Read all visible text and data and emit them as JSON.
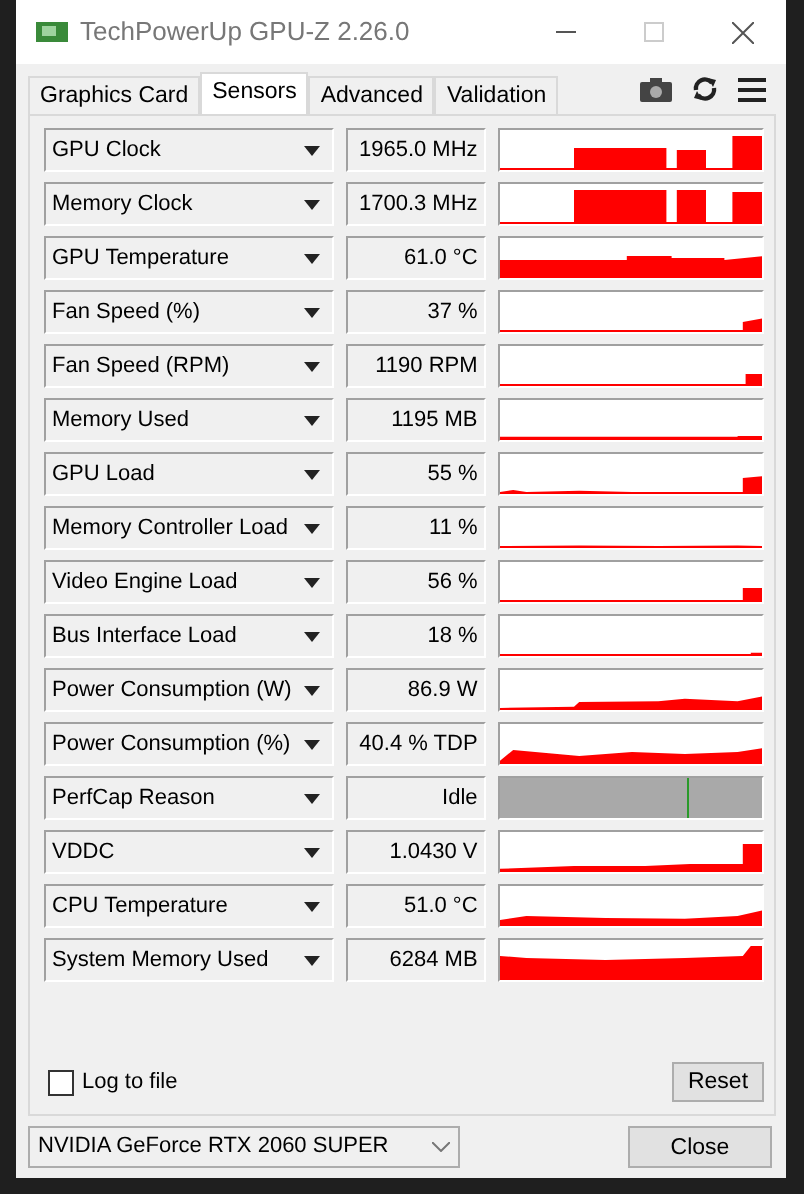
{
  "window": {
    "title": "TechPowerUp GPU-Z 2.26.0"
  },
  "tabs": [
    {
      "label": "Graphics Card",
      "selected": false
    },
    {
      "label": "Sensors",
      "selected": true
    },
    {
      "label": "Advanced",
      "selected": false
    },
    {
      "label": "Validation",
      "selected": false
    }
  ],
  "sensors": [
    {
      "name": "GPU Clock",
      "value": "1965.0 MHz",
      "kind": "graph"
    },
    {
      "name": "Memory Clock",
      "value": "1700.3 MHz",
      "kind": "graph"
    },
    {
      "name": "GPU Temperature",
      "value": "61.0 °C",
      "kind": "graph"
    },
    {
      "name": "Fan Speed (%)",
      "value": "37 %",
      "kind": "graph"
    },
    {
      "name": "Fan Speed (RPM)",
      "value": "1190 RPM",
      "kind": "graph"
    },
    {
      "name": "Memory Used",
      "value": "1195 MB",
      "kind": "graph"
    },
    {
      "name": "GPU Load",
      "value": "55 %",
      "kind": "graph"
    },
    {
      "name": "Memory Controller Load",
      "value": "11 %",
      "kind": "graph"
    },
    {
      "name": "Video Engine Load",
      "value": "56 %",
      "kind": "graph"
    },
    {
      "name": "Bus Interface Load",
      "value": "18 %",
      "kind": "graph"
    },
    {
      "name": "Power Consumption (W)",
      "value": "86.9 W",
      "kind": "graph"
    },
    {
      "name": "Power Consumption (%)",
      "value": "40.4 % TDP",
      "kind": "graph"
    },
    {
      "name": "PerfCap Reason",
      "value": "Idle",
      "kind": "status"
    },
    {
      "name": "VDDC",
      "value": "1.0430 V",
      "kind": "graph"
    },
    {
      "name": "CPU Temperature",
      "value": "51.0 °C",
      "kind": "graph"
    },
    {
      "name": "System Memory Used",
      "value": "6284 MB",
      "kind": "graph"
    }
  ],
  "log_to_file": {
    "label": "Log to file",
    "checked": false
  },
  "reset_button": "Reset",
  "gpu_select": {
    "value": "NVIDIA GeForce RTX 2060 SUPER"
  },
  "close_button": "Close"
}
